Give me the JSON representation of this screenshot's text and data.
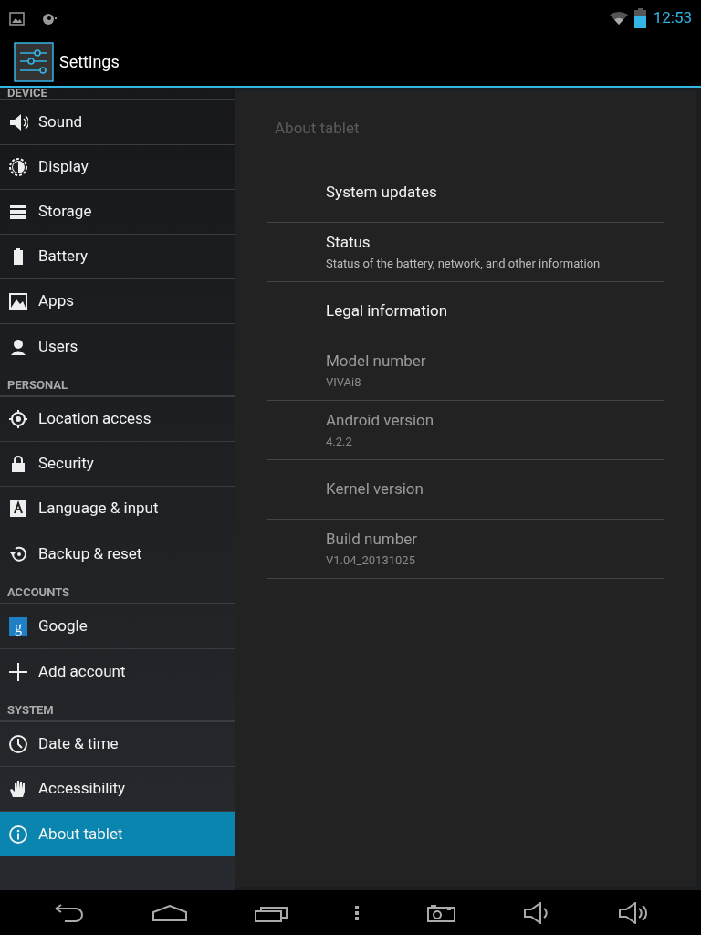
{
  "status_bar": {
    "time": "12:53"
  },
  "action_bar": {
    "title": "Settings"
  },
  "sidebar": {
    "sections": [
      {
        "header": "DEVICE",
        "items": [
          {
            "label": "Sound",
            "selected": false
          },
          {
            "label": "Display",
            "selected": false
          },
          {
            "label": "Storage",
            "selected": false
          },
          {
            "label": "Battery",
            "selected": false
          },
          {
            "label": "Apps",
            "selected": false
          },
          {
            "label": "Users",
            "selected": false
          }
        ]
      },
      {
        "header": "PERSONAL",
        "items": [
          {
            "label": "Location access",
            "selected": false
          },
          {
            "label": "Security",
            "selected": false
          },
          {
            "label": "Language & input",
            "selected": false
          },
          {
            "label": "Backup & reset",
            "selected": false
          }
        ]
      },
      {
        "header": "ACCOUNTS",
        "items": [
          {
            "label": "Google",
            "icon_letter": "g",
            "selected": false
          },
          {
            "label": "Add account",
            "selected": false
          }
        ]
      },
      {
        "header": "SYSTEM",
        "items": [
          {
            "label": "Date & time",
            "selected": false
          },
          {
            "label": "Accessibility",
            "selected": false
          },
          {
            "label": "About tablet",
            "selected": true
          }
        ]
      }
    ]
  },
  "detail": {
    "title": "About tablet",
    "items": [
      {
        "title": "System updates",
        "disabled": false
      },
      {
        "title": "Status",
        "summary": "Status of the battery, network, and other information",
        "disabled": false
      },
      {
        "title": "Legal information",
        "disabled": false
      },
      {
        "title": "Model number",
        "summary": "VIVAi8",
        "disabled": true
      },
      {
        "title": "Android version",
        "summary": "4.2.2",
        "disabled": true
      },
      {
        "title": "Kernel version",
        "disabled": true
      },
      {
        "title": "Build number",
        "summary": "V1.04_20131025",
        "disabled": true
      }
    ]
  }
}
